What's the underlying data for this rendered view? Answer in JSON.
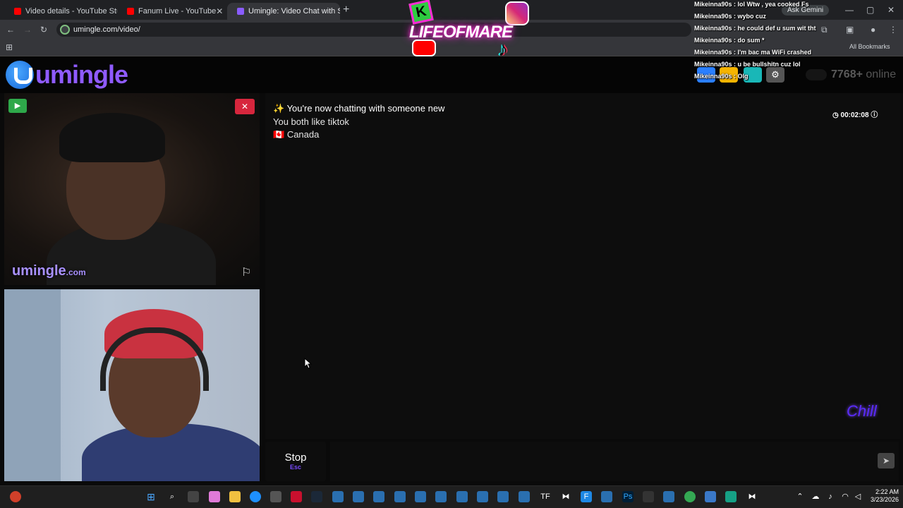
{
  "browser": {
    "tabs": [
      {
        "title": "Video details - YouTube Studio",
        "favicon_color": "#ff0000"
      },
      {
        "title": "Fanum Live - YouTube",
        "favicon_color": "#ff0000"
      },
      {
        "title": "Umingle: Video Chat with S",
        "favicon_color": "#8a5cff"
      }
    ],
    "url": "umingle.com/video/",
    "ask_gemini": "Ask Gemini",
    "all_bookmarks": "All Bookmarks"
  },
  "header": {
    "logo_text": "umingle",
    "online_count": "7768+",
    "online_label": "online"
  },
  "overlay": {
    "stream_name": "LIFEOFMARE",
    "stream_k": "K",
    "chat": [
      "Mikeinna90s : lol Wtw , yea cooked Fs",
      "Mikeinna90s : wybo cuz",
      "Mikeinna90s : he could def u sum wit tht",
      "Mikeinna90s : do sum *",
      "Mikeinna90s : I'm bac ma WiFi crashed",
      "Mikeinna90s : u be bullshitn cuz lol",
      "Mikeinna90s : Olg"
    ]
  },
  "video": {
    "watermark": "umingle",
    "watermark_tld": ".com"
  },
  "chat": {
    "intro_emoji": "✨",
    "intro": "You're now chatting with someone new",
    "common_interest": "You both like tiktok",
    "country_flag": "🇨🇦",
    "country": "Canada",
    "timer": "00:02:08"
  },
  "controls": {
    "stop_label": "Stop",
    "stop_key": "Esc",
    "message_placeholder": "",
    "chill_logo": "Chill"
  },
  "taskbar": {
    "time": "2:22 AM",
    "date": "3/23/2026"
  },
  "colors": {
    "accent": "#8f5bff",
    "green": "#2ea84a",
    "red": "#d7263d"
  }
}
